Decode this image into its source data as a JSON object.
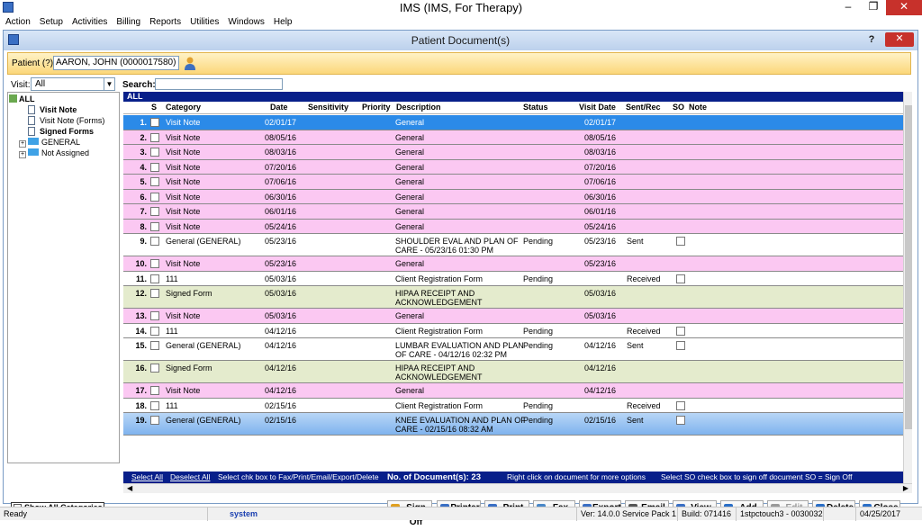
{
  "app": {
    "title": "IMS (IMS, For Therapy)",
    "min": "–",
    "restore": "❐",
    "close": "✕"
  },
  "menu": [
    "Action",
    "Setup",
    "Activities",
    "Billing",
    "Reports",
    "Utilities",
    "Windows",
    "Help"
  ],
  "doc_window": {
    "title": "Patient Document(s)",
    "help": "?",
    "close": "✕"
  },
  "patient": {
    "label": "Patient (?)",
    "value": "AARON, JOHN  (0000017580)"
  },
  "visit": {
    "label": "Visit:",
    "value": "All"
  },
  "search": {
    "label": "Search:",
    "value": ""
  },
  "tree": {
    "root": "ALL",
    "children": [
      "Visit Note",
      "Visit Note (Forms)",
      "Signed Forms"
    ],
    "folders": [
      "GENERAL",
      "Not Assigned"
    ]
  },
  "grid": {
    "group_label": "ALL",
    "columns": [
      "S",
      "Category",
      "Date",
      "Sensitivity",
      "Priority",
      "Description",
      "Status",
      "Visit Date",
      "Sent/Rec",
      "SO",
      "Note"
    ],
    "rows": [
      {
        "num": "1.",
        "category": "Visit Note",
        "date": "02/01/17",
        "description": "General",
        "status": "",
        "visit_date": "02/01/17",
        "sent": "",
        "so": false,
        "style": "selected"
      },
      {
        "num": "2.",
        "category": "Visit Note",
        "date": "08/05/16",
        "description": "General",
        "status": "",
        "visit_date": "08/05/16",
        "sent": "",
        "so": false,
        "style": "pink"
      },
      {
        "num": "3.",
        "category": "Visit Note",
        "date": "08/03/16",
        "description": "General",
        "status": "",
        "visit_date": "08/03/16",
        "sent": "",
        "so": false,
        "style": "pink"
      },
      {
        "num": "4.",
        "category": "Visit Note",
        "date": "07/20/16",
        "description": "General",
        "status": "",
        "visit_date": "07/20/16",
        "sent": "",
        "so": false,
        "style": "pink"
      },
      {
        "num": "5.",
        "category": "Visit Note",
        "date": "07/06/16",
        "description": "General",
        "status": "",
        "visit_date": "07/06/16",
        "sent": "",
        "so": false,
        "style": "pink"
      },
      {
        "num": "6.",
        "category": "Visit Note",
        "date": "06/30/16",
        "description": "General",
        "status": "",
        "visit_date": "06/30/16",
        "sent": "",
        "so": false,
        "style": "pink"
      },
      {
        "num": "7.",
        "category": "Visit Note",
        "date": "06/01/16",
        "description": "General",
        "status": "",
        "visit_date": "06/01/16",
        "sent": "",
        "so": false,
        "style": "pink"
      },
      {
        "num": "8.",
        "category": "Visit Note",
        "date": "05/24/16",
        "description": "General",
        "status": "",
        "visit_date": "05/24/16",
        "sent": "",
        "so": false,
        "style": "pink"
      },
      {
        "num": "9.",
        "category": "General (GENERAL)",
        "date": "05/23/16",
        "description": "SHOULDER EVAL AND PLAN OF\nCARE - 05/23/16 01:30 PM",
        "status": "Pending",
        "visit_date": "05/23/16",
        "sent": "Sent",
        "so": true,
        "style": "white"
      },
      {
        "num": "10.",
        "category": "Visit Note",
        "date": "05/23/16",
        "description": "General",
        "status": "",
        "visit_date": "05/23/16",
        "sent": "",
        "so": false,
        "style": "pink"
      },
      {
        "num": "11.",
        "category": "111",
        "date": "05/03/16",
        "description": "Client Registration Form",
        "status": "Pending",
        "visit_date": "",
        "sent": "Received",
        "so": true,
        "style": "white"
      },
      {
        "num": "12.",
        "category": "Signed Form",
        "date": "05/03/16",
        "description": "HIPAA RECEIPT AND\nACKNOWLEDGEMENT",
        "status": "",
        "visit_date": "05/03/16",
        "sent": "",
        "so": false,
        "style": "green"
      },
      {
        "num": "13.",
        "category": "Visit Note",
        "date": "05/03/16",
        "description": "General",
        "status": "",
        "visit_date": "05/03/16",
        "sent": "",
        "so": false,
        "style": "pink"
      },
      {
        "num": "14.",
        "category": "111",
        "date": "04/12/16",
        "description": "Client Registration Form",
        "status": "Pending",
        "visit_date": "",
        "sent": "Received",
        "so": true,
        "style": "white"
      },
      {
        "num": "15.",
        "category": "General (GENERAL)",
        "date": "04/12/16",
        "description": "LUMBAR EVALUATION AND PLAN\nOF CARE - 04/12/16 02:32 PM",
        "status": "Pending",
        "visit_date": "04/12/16",
        "sent": "Sent",
        "so": true,
        "style": "white"
      },
      {
        "num": "16.",
        "category": "Signed Form",
        "date": "04/12/16",
        "description": "HIPAA RECEIPT AND\nACKNOWLEDGEMENT",
        "status": "",
        "visit_date": "04/12/16",
        "sent": "",
        "so": false,
        "style": "green"
      },
      {
        "num": "17.",
        "category": "Visit Note",
        "date": "04/12/16",
        "description": "General",
        "status": "",
        "visit_date": "04/12/16",
        "sent": "",
        "so": false,
        "style": "pink"
      },
      {
        "num": "18.",
        "category": "111",
        "date": "02/15/16",
        "description": "Client Registration Form",
        "status": "Pending",
        "visit_date": "",
        "sent": "Received",
        "so": true,
        "style": "white"
      },
      {
        "num": "19.",
        "category": "General (GENERAL)",
        "date": "02/15/16",
        "description": "KNEE EVALUATION AND PLAN OF\nCARE - 02/15/16 08:32 AM",
        "status": "Pending",
        "visit_date": "02/15/16",
        "sent": "Sent",
        "so": true,
        "style": "selected2"
      }
    ]
  },
  "footer": {
    "select_all": "Select All",
    "deselect_all": "Deselect All",
    "hint": "Select chk box to Fax/Print/Email/Export/Delete",
    "count": "No. of Document(s): 23",
    "right_click": "Right click on document for more options",
    "so_hint": "Select SO check box to sign off document   SO = Sign Off"
  },
  "show_all_categories": "Show All Categories",
  "buttons": [
    {
      "label": "Sign Off",
      "color": "#e0a020",
      "disabled": false
    },
    {
      "label": "Printer",
      "color": "#3a6fc4",
      "disabled": false
    },
    {
      "label": "Print",
      "color": "#3a6fc4",
      "disabled": false
    },
    {
      "label": "Fax",
      "color": "#4a88c8",
      "disabled": false
    },
    {
      "label": "Export",
      "color": "#3a6fc4",
      "disabled": false
    },
    {
      "label": "Email",
      "color": "#555555",
      "disabled": false
    },
    {
      "label": "View",
      "color": "#3a6fc4",
      "disabled": false
    },
    {
      "label": "Add",
      "color": "#2b6fc7",
      "disabled": false
    },
    {
      "label": "Edit",
      "color": "#999999",
      "disabled": true
    },
    {
      "label": "Delete",
      "color": "#2b6fc7",
      "disabled": false
    },
    {
      "label": "Close",
      "color": "#2b6fc7",
      "disabled": false
    }
  ],
  "status": {
    "ready": "Ready",
    "user": "system",
    "version": "Ver: 14.0.0 Service Pack 1",
    "build": "Build: 071416",
    "server": "1stpctouch3 - 0030032",
    "date": "04/25/2017"
  }
}
